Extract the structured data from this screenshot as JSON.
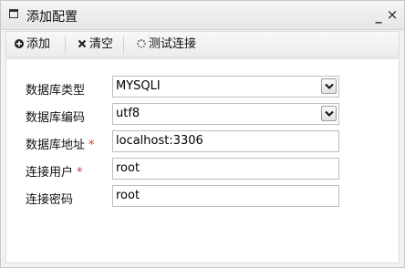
{
  "window": {
    "title": "添加配置",
    "minimize_glyph": "_",
    "close_glyph": "×"
  },
  "toolbar": {
    "add_label": "添加",
    "clear_label": "清空",
    "test_label": "测试连接"
  },
  "form": {
    "db_type": {
      "label": "数据库类型",
      "value": "MYSQLI",
      "required": false
    },
    "db_encoding": {
      "label": "数据库编码",
      "value": "utf8",
      "required": false
    },
    "db_address": {
      "label": "数据库地址",
      "value": "localhost:3306",
      "required": true
    },
    "db_user": {
      "label": "连接用户",
      "value": "root",
      "required": true
    },
    "db_password": {
      "label": "连接密码",
      "value": "root",
      "required": false
    }
  },
  "required_marker": "*",
  "icons": {
    "window": "window-icon",
    "add": "plus-circle-icon",
    "clear": "x-icon",
    "test": "spinner-icon",
    "dropdown": "chevron-down-icon"
  },
  "colors": {
    "required": "#e03030",
    "border": "#bdbdbd"
  }
}
